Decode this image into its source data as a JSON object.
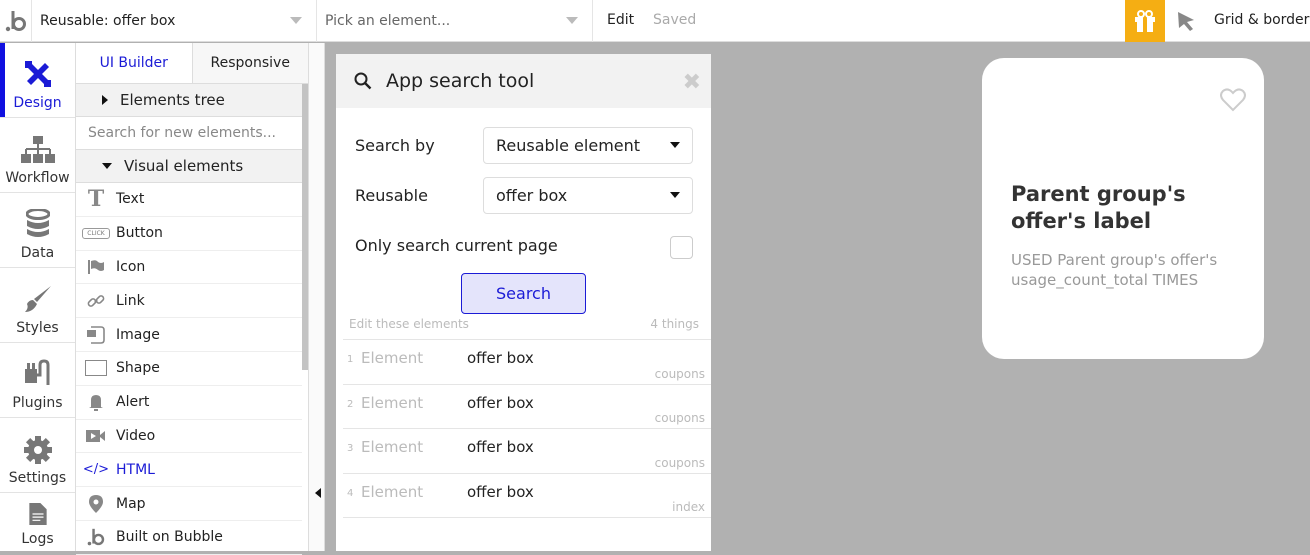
{
  "topbar": {
    "page_selector": "Reusable: offer box",
    "element_picker_placeholder": "Pick an element...",
    "edit_label": "Edit",
    "save_status": "Saved",
    "grid_label": "Grid & borders",
    "gift_color": "#f5ae13"
  },
  "leftnav": {
    "items": [
      {
        "label": "Design",
        "icon": "design-icon",
        "active": true
      },
      {
        "label": "Workflow",
        "icon": "workflow-icon"
      },
      {
        "label": "Data",
        "icon": "database-icon"
      },
      {
        "label": "Styles",
        "icon": "brush-icon"
      },
      {
        "label": "Plugins",
        "icon": "plug-icon"
      },
      {
        "label": "Settings",
        "icon": "gear-icon"
      },
      {
        "label": "Logs",
        "icon": "document-icon"
      }
    ]
  },
  "panel": {
    "tabs": [
      {
        "label": "UI Builder"
      },
      {
        "label": "Responsive"
      }
    ],
    "elements_tree": "Elements tree",
    "search_placeholder": "Search for new elements...",
    "visual_elements": "Visual elements",
    "elements": [
      {
        "label": "Text",
        "icon": "text-icon"
      },
      {
        "label": "Button",
        "icon": "button-icon"
      },
      {
        "label": "Icon",
        "icon": "flag-icon"
      },
      {
        "label": "Link",
        "icon": "link-icon"
      },
      {
        "label": "Image",
        "icon": "image-icon"
      },
      {
        "label": "Shape",
        "icon": "shape-icon"
      },
      {
        "label": "Alert",
        "icon": "bell-icon"
      },
      {
        "label": "Video",
        "icon": "video-icon"
      },
      {
        "label": "HTML",
        "icon": "code-icon"
      },
      {
        "label": "Map",
        "icon": "map-pin-icon"
      },
      {
        "label": "Built on Bubble",
        "icon": "bubble-logo-icon"
      }
    ]
  },
  "modal": {
    "title": "App search tool",
    "search_by_label": "Search by",
    "search_by_value": "Reusable element",
    "reusable_label": "Reusable",
    "reusable_value": "offer box",
    "only_current_label": "Only search current page",
    "only_current_checked": false,
    "search_button": "Search",
    "edit_these": "Edit these elements",
    "count": "4 things",
    "results": [
      {
        "n": "1",
        "kind": "Element",
        "name": "offer box",
        "page": "coupons"
      },
      {
        "n": "2",
        "kind": "Element",
        "name": "offer box",
        "page": "coupons"
      },
      {
        "n": "3",
        "kind": "Element",
        "name": "offer box",
        "page": "coupons"
      },
      {
        "n": "4",
        "kind": "Element",
        "name": "offer box",
        "page": "index"
      }
    ]
  },
  "card": {
    "title": "Parent group's offer's label",
    "subtitle": "USED Parent group's offer's usage_count_total TIMES"
  }
}
